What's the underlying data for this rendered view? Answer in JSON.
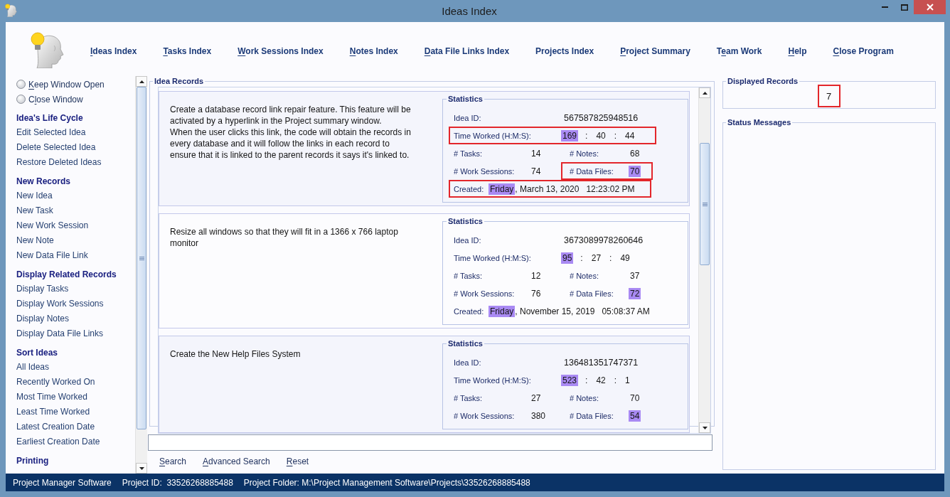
{
  "window": {
    "title": "Ideas Index"
  },
  "nav": [
    {
      "label": [
        {
          "text": "I",
          "underlined": true
        },
        {
          "text": "deas Index",
          "underlined": false
        }
      ]
    },
    {
      "label": [
        {
          "text": "T",
          "underlined": true
        },
        {
          "text": "asks Index",
          "underlined": false
        }
      ]
    },
    {
      "label": [
        {
          "text": "W",
          "underlined": true
        },
        {
          "text": "ork Sessions Index",
          "underlined": false
        }
      ]
    },
    {
      "label": [
        {
          "text": "N",
          "underlined": true
        },
        {
          "text": "otes Index",
          "underlined": false
        }
      ]
    },
    {
      "label": [
        {
          "text": "D",
          "underlined": true
        },
        {
          "text": "ata File Links Index",
          "underlined": false
        }
      ]
    },
    {
      "label": [
        {
          "text": "Projects Index",
          "underlined": false
        }
      ]
    },
    {
      "label": [
        {
          "text": "P",
          "underlined": true
        },
        {
          "text": "roject Summary",
          "underlined": false
        }
      ]
    },
    {
      "label": [
        {
          "text": "T",
          "underlined": false
        },
        {
          "text": "e",
          "underlined": true
        },
        {
          "text": "am Work",
          "underlined": false
        }
      ]
    },
    {
      "label": [
        {
          "text": "H",
          "underlined": true
        },
        {
          "text": "elp",
          "underlined": false
        }
      ]
    },
    {
      "label": [
        {
          "text": "C",
          "underlined": true
        },
        {
          "text": "lose Program",
          "underlined": false
        }
      ]
    }
  ],
  "sidebar": {
    "window_options": [
      {
        "label": [
          {
            "text": "K",
            "underlined": true
          },
          {
            "text": "eep Window Open",
            "underlined": false
          }
        ],
        "selected": false
      },
      {
        "label": [
          {
            "text": "C",
            "underlined": false
          },
          {
            "text": "l",
            "underlined": true
          },
          {
            "text": "ose Window",
            "underlined": false
          }
        ],
        "selected": false
      }
    ],
    "sections": [
      {
        "title": "Idea's Life Cycle",
        "items": [
          "Edit Selected Idea",
          "Delete Selected Idea",
          "Restore Deleted Ideas"
        ]
      },
      {
        "title": "New Records",
        "items": [
          "New Idea",
          "New Task",
          "New Work Session",
          "New Note",
          "New Data File Link"
        ]
      },
      {
        "title": "Display Related Records",
        "items": [
          "Display Tasks",
          "Display Work Sessions",
          "Display Notes",
          "Display Data File Links"
        ]
      },
      {
        "title": "Sort Ideas",
        "items": [
          "All Ideas",
          "Recently Worked On",
          "Most Time Worked",
          "Least Time Worked",
          "Latest Creation Date",
          "Earliest Creation Date"
        ]
      },
      {
        "title": "Printing"
      }
    ]
  },
  "idea_records": {
    "title": "Idea Records",
    "records": [
      {
        "description": [
          "Create a database record link repair feature. This feature will be activated by a hyperlink in the Project summary window.",
          "When the user clicks this link, the code will obtain the records in every database and it will follow the links in each record to ensure that it is linked to the parent records it says it's linked to."
        ],
        "statistics": {
          "title": "Statistics",
          "idea_id": {
            "label": "Idea ID:",
            "value": "567587825948516"
          },
          "time_worked": {
            "label": "Time Worked (H:M:S):",
            "annotated": true,
            "parts": [
              {
                "text": "169",
                "highlighted": true
              },
              {
                "text": ":",
                "highlighted": false
              },
              {
                "text": "40",
                "highlighted": false
              },
              {
                "text": ":",
                "highlighted": false
              },
              {
                "text": "44",
                "highlighted": false
              }
            ]
          },
          "counts": [
            {
              "label": "# Tasks:",
              "value": "14",
              "highlighted": false,
              "annotated": false
            },
            {
              "label": "# Notes:",
              "value": "68",
              "highlighted": false,
              "annotated": false
            },
            {
              "label": "# Work Sessions:",
              "value": "74",
              "highlighted": false,
              "annotated": false
            },
            {
              "label": "# Data Files:",
              "value": "70",
              "highlighted": true,
              "annotated": true
            }
          ],
          "created": {
            "label": "Created:",
            "annotated": true,
            "weekday": {
              "text": "Friday",
              "highlighted": true
            },
            "date": ", March 13, 2020",
            "time": "12:23:02 PM"
          }
        }
      },
      {
        "description": [
          "Resize all windows so that they will fit in a 1366 x 766 laptop monitor"
        ],
        "statistics": {
          "title": "Statistics",
          "idea_id": {
            "label": "Idea ID:",
            "value": "3673089978260646"
          },
          "time_worked": {
            "label": "Time Worked (H:M:S):",
            "annotated": false,
            "parts": [
              {
                "text": "95",
                "highlighted": true
              },
              {
                "text": ":",
                "highlighted": false
              },
              {
                "text": "27",
                "highlighted": false
              },
              {
                "text": ":",
                "highlighted": false
              },
              {
                "text": "49",
                "highlighted": false
              }
            ]
          },
          "counts": [
            {
              "label": "# Tasks:",
              "value": "12",
              "highlighted": false,
              "annotated": false
            },
            {
              "label": "# Notes:",
              "value": "37",
              "highlighted": false,
              "annotated": false
            },
            {
              "label": "# Work Sessions:",
              "value": "76",
              "highlighted": false,
              "annotated": false
            },
            {
              "label": "# Data Files:",
              "value": "72",
              "highlighted": true,
              "annotated": false
            }
          ],
          "created": {
            "label": "Created:",
            "annotated": false,
            "weekday": {
              "text": "Friday",
              "highlighted": true
            },
            "date": ", November 15, 2019",
            "time": "05:08:37 AM"
          }
        }
      },
      {
        "description": [
          "Create the New Help Files System"
        ],
        "statistics": {
          "title": "Statistics",
          "idea_id": {
            "label": "Idea ID:",
            "value": "136481351747371"
          },
          "time_worked": {
            "label": "Time Worked (H:M:S):",
            "annotated": false,
            "parts": [
              {
                "text": "523",
                "highlighted": true
              },
              {
                "text": ":",
                "highlighted": false
              },
              {
                "text": "42",
                "highlighted": false
              },
              {
                "text": ":",
                "highlighted": false
              },
              {
                "text": "1",
                "highlighted": false
              }
            ]
          },
          "counts": [
            {
              "label": "# Tasks:",
              "value": "27",
              "highlighted": false,
              "annotated": false
            },
            {
              "label": "# Notes:",
              "value": "70",
              "highlighted": false,
              "annotated": false
            },
            {
              "label": "# Work Sessions:",
              "value": "380",
              "highlighted": false,
              "annotated": false
            },
            {
              "label": "# Data Files:",
              "value": "54",
              "highlighted": true,
              "annotated": false
            }
          ]
        }
      }
    ]
  },
  "search": {
    "buttons": [
      {
        "label": [
          {
            "text": "S",
            "underlined": true
          },
          {
            "text": "earch",
            "underlined": false
          }
        ]
      },
      {
        "label": [
          {
            "text": "A",
            "underlined": true
          },
          {
            "text": "dvanced Search",
            "underlined": false
          }
        ]
      },
      {
        "label": [
          {
            "text": "R",
            "underlined": true
          },
          {
            "text": "eset",
            "underlined": false
          }
        ]
      }
    ]
  },
  "displayed_records": {
    "title": "Displayed Records",
    "value": "7",
    "annotated": true
  },
  "status_messages": {
    "title": "Status Messages"
  },
  "status_bar": [
    "Project Manager Software",
    "Project ID:  33526268885488",
    "Project Folder: M:\\Project Management Software\\Projects\\33526268885488"
  ]
}
